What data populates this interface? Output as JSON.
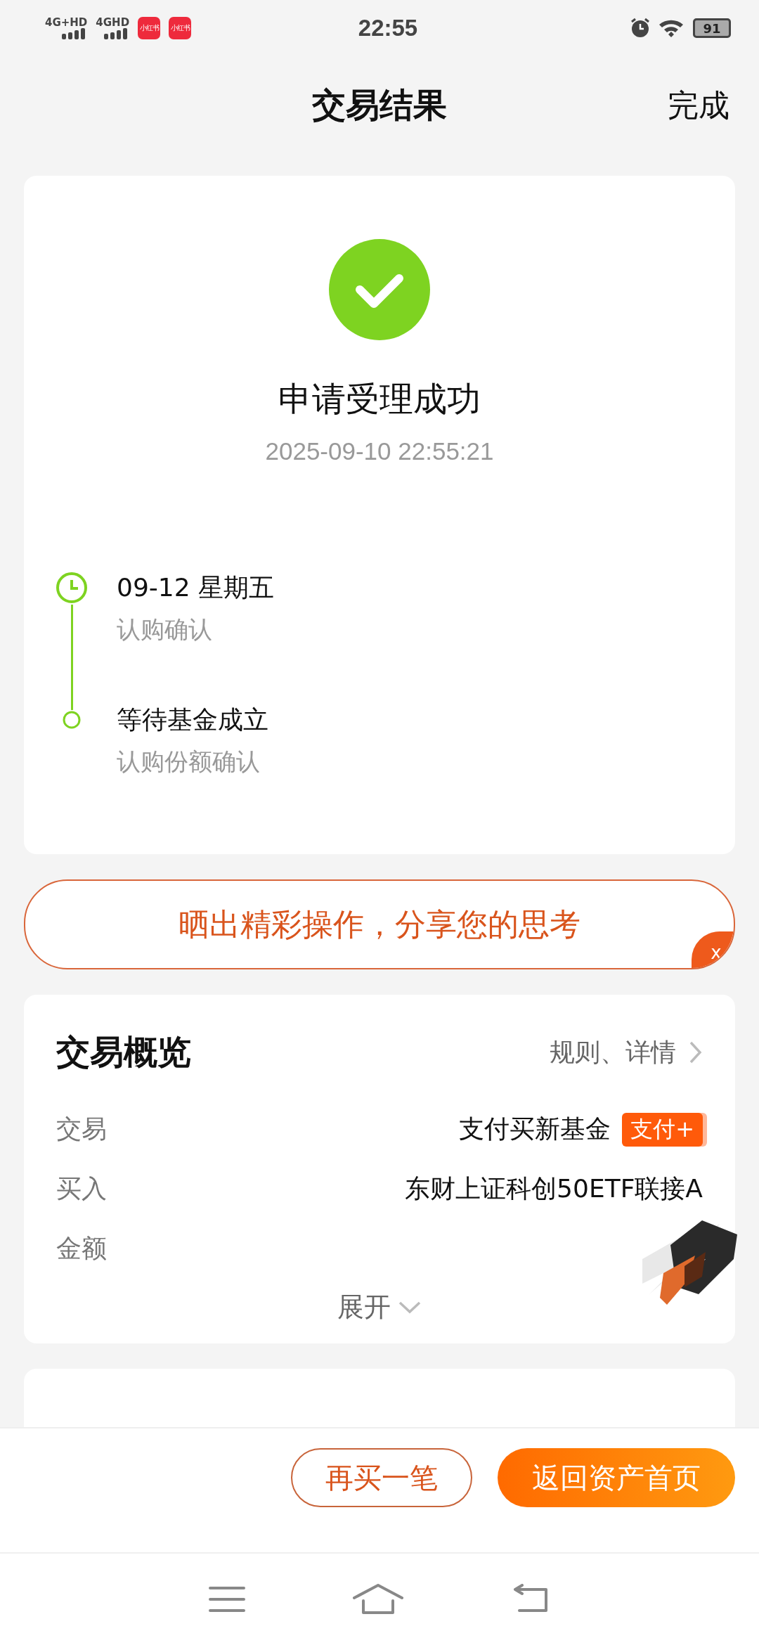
{
  "status_bar": {
    "networks": [
      "4G+HD",
      "4GHD"
    ],
    "app_icons": [
      "小红书",
      "小红书"
    ],
    "time": "22:55",
    "battery": "91"
  },
  "header": {
    "title": "交易结果",
    "action": "完成"
  },
  "result": {
    "title": "申请受理成功",
    "time": "2025-09-10 22:55:21",
    "timeline": [
      {
        "kind": "clock",
        "title": "09-12  星期五",
        "subtitle": "认购确认"
      },
      {
        "kind": "dot",
        "title": "等待基金成立",
        "subtitle": "认购份额确认"
      }
    ]
  },
  "share_banner": {
    "text": "晒出精彩操作，分享您的思考",
    "close": "x"
  },
  "overview": {
    "title": "交易概览",
    "link": "规则、详情",
    "rows": [
      {
        "label": "交易",
        "value": "支付买新基金",
        "tag": "支付+"
      },
      {
        "label": "买入",
        "value": "东财上证科创50ETF联接A"
      },
      {
        "label": "金额"
      }
    ],
    "expand": "展开"
  },
  "actions": [
    {
      "kind": "outline",
      "label": "再买一笔"
    },
    {
      "kind": "primary",
      "label": "返回资产首页"
    }
  ]
}
